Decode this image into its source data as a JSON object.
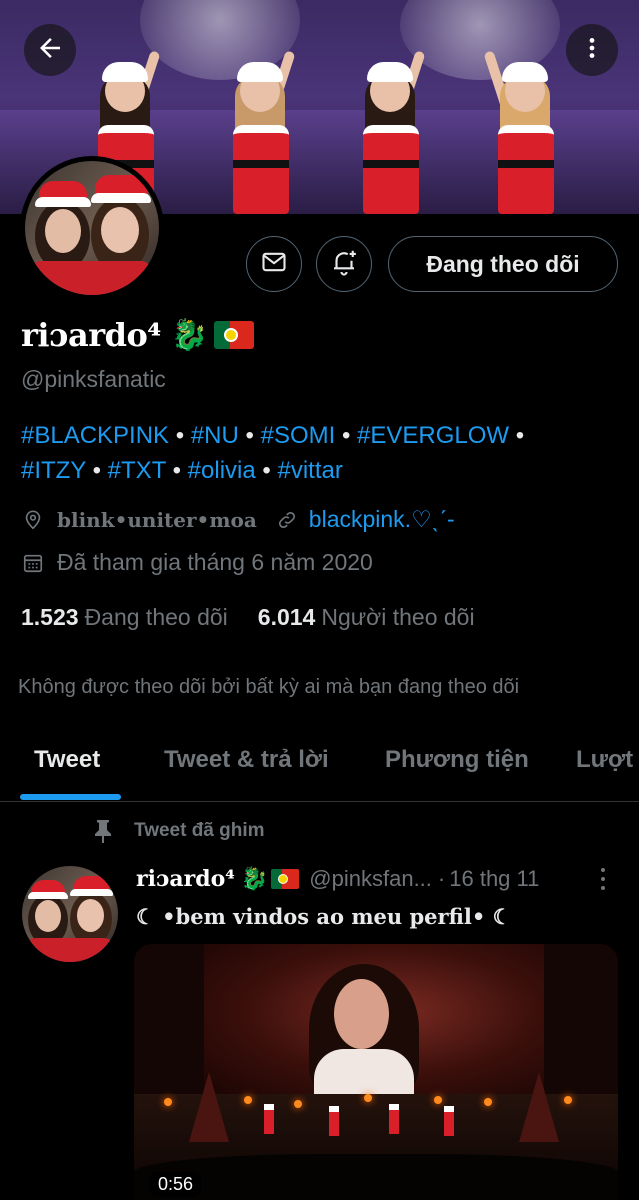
{
  "profile": {
    "name": "riɔardo⁴",
    "name_emoji": "🐉",
    "handle": "@pinksfanatic",
    "bio_line1": [
      {
        "text": "#BLACKPINK",
        "type": "tag"
      },
      {
        "text": " • ",
        "type": "plain"
      },
      {
        "text": "#NU",
        "type": "tag"
      },
      {
        "text": " • ",
        "type": "plain"
      },
      {
        "text": "#SOMI",
        "type": "tag"
      },
      {
        "text": " • ",
        "type": "plain"
      },
      {
        "text": "#EVERGLOW",
        "type": "tag"
      },
      {
        "text": " •",
        "type": "plain"
      }
    ],
    "bio_line2": [
      {
        "text": "#ITZY",
        "type": "tag"
      },
      {
        "text": " • ",
        "type": "plain"
      },
      {
        "text": "#TXT",
        "type": "tag"
      },
      {
        "text": " • ",
        "type": "plain"
      },
      {
        "text": "#olivia",
        "type": "tag"
      },
      {
        "text": " • ",
        "type": "plain"
      },
      {
        "text": "#vittar",
        "type": "tag"
      }
    ],
    "location": "blink•uniter•moa",
    "website": "blackpink.♡ˎˊ-",
    "joined": "Đã tham gia tháng 6 năm 2020",
    "following_count": "1.523",
    "following_label": "Đang theo dõi",
    "followers_count": "6.014",
    "followers_label": "Người theo dõi",
    "not_followed_note": "Không được theo dõi bởi bất kỳ ai mà bạn đang theo dõi"
  },
  "actions": {
    "follow_label": "Đang theo dõi",
    "message_icon": "mail-icon",
    "notify_icon": "bell-plus-icon",
    "back_icon": "arrow-left-icon",
    "more_icon": "more-vertical-icon"
  },
  "tabs": [
    {
      "label": "Tweet",
      "active": true
    },
    {
      "label": "Tweet & trả lời",
      "active": false
    },
    {
      "label": "Phương tiện",
      "active": false
    },
    {
      "label": "Lượt",
      "active": false
    }
  ],
  "pinned_tweet": {
    "pinned_label": "Tweet đã ghim",
    "author_name": "riɔardo⁴",
    "author_emoji": "🐉",
    "author_handle": "@pinksfan...",
    "separator": "·",
    "time": "16 thg 11",
    "text": "☾ •bem vindos ao meu perfil• ☾",
    "video_duration": "0:56"
  },
  "colors": {
    "accent": "#1d9bf0",
    "background": "#000000",
    "secondary_text": "#71767b",
    "primary_text": "#e7e9ea",
    "border": "#2f3336"
  }
}
